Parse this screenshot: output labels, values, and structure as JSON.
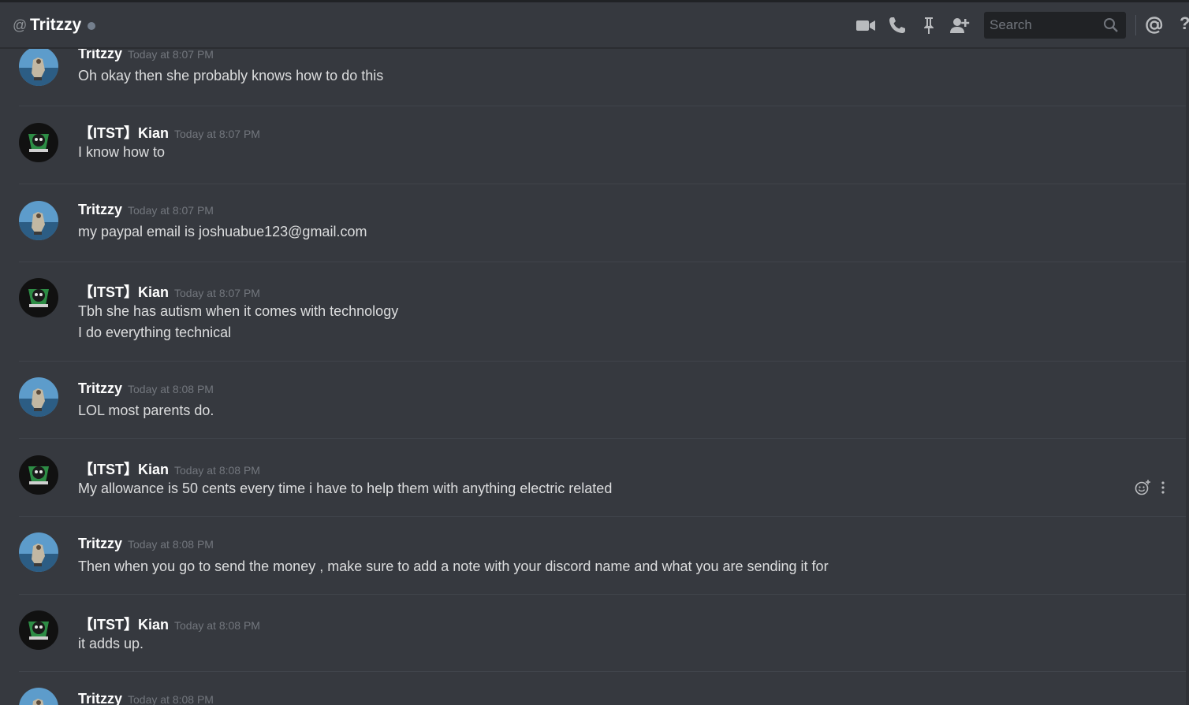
{
  "header": {
    "at_symbol": "@",
    "channel_name": "Tritzzy",
    "search_placeholder": "Search",
    "help_label": "?"
  },
  "messages": [
    {
      "author": "Tritzzy",
      "timestamp": "Today at 8:07 PM",
      "avatar": "dog-avatar",
      "lines": [
        "Oh okay then she probably knows how to do this"
      ]
    },
    {
      "author": "【ITST】Kian",
      "timestamp": "Today at 8:07 PM",
      "avatar": "intensity-avatar",
      "lines": [
        "I know how to"
      ]
    },
    {
      "author": "Tritzzy",
      "timestamp": "Today at 8:07 PM",
      "avatar": "dog-avatar",
      "lines": [
        "my paypal email is joshuabue123@gmail.com"
      ]
    },
    {
      "author": "【ITST】Kian",
      "timestamp": "Today at 8:07 PM",
      "avatar": "intensity-avatar",
      "lines": [
        "Tbh she has autism when it comes with technology",
        "I do everything technical"
      ]
    },
    {
      "author": "Tritzzy",
      "timestamp": "Today at 8:08 PM",
      "avatar": "dog-avatar",
      "lines": [
        "LOL most parents do."
      ]
    },
    {
      "author": "【ITST】Kian",
      "timestamp": "Today at 8:08 PM",
      "avatar": "intensity-avatar",
      "lines": [
        "My allowance is 50 cents every time i have to help them with anything electric related"
      ]
    },
    {
      "author": "Tritzzy",
      "timestamp": "Today at 8:08 PM",
      "avatar": "dog-avatar",
      "lines": [
        "Then when you go to send the money , make sure to add a note with your discord name and what you are sending it for"
      ]
    },
    {
      "author": "【ITST】Kian",
      "timestamp": "Today at 8:08 PM",
      "avatar": "intensity-avatar",
      "lines": [
        "it adds up."
      ]
    },
    {
      "author": "Tritzzy",
      "timestamp": "Today at 8:08 PM",
      "avatar": "dog-avatar",
      "lines": []
    }
  ]
}
